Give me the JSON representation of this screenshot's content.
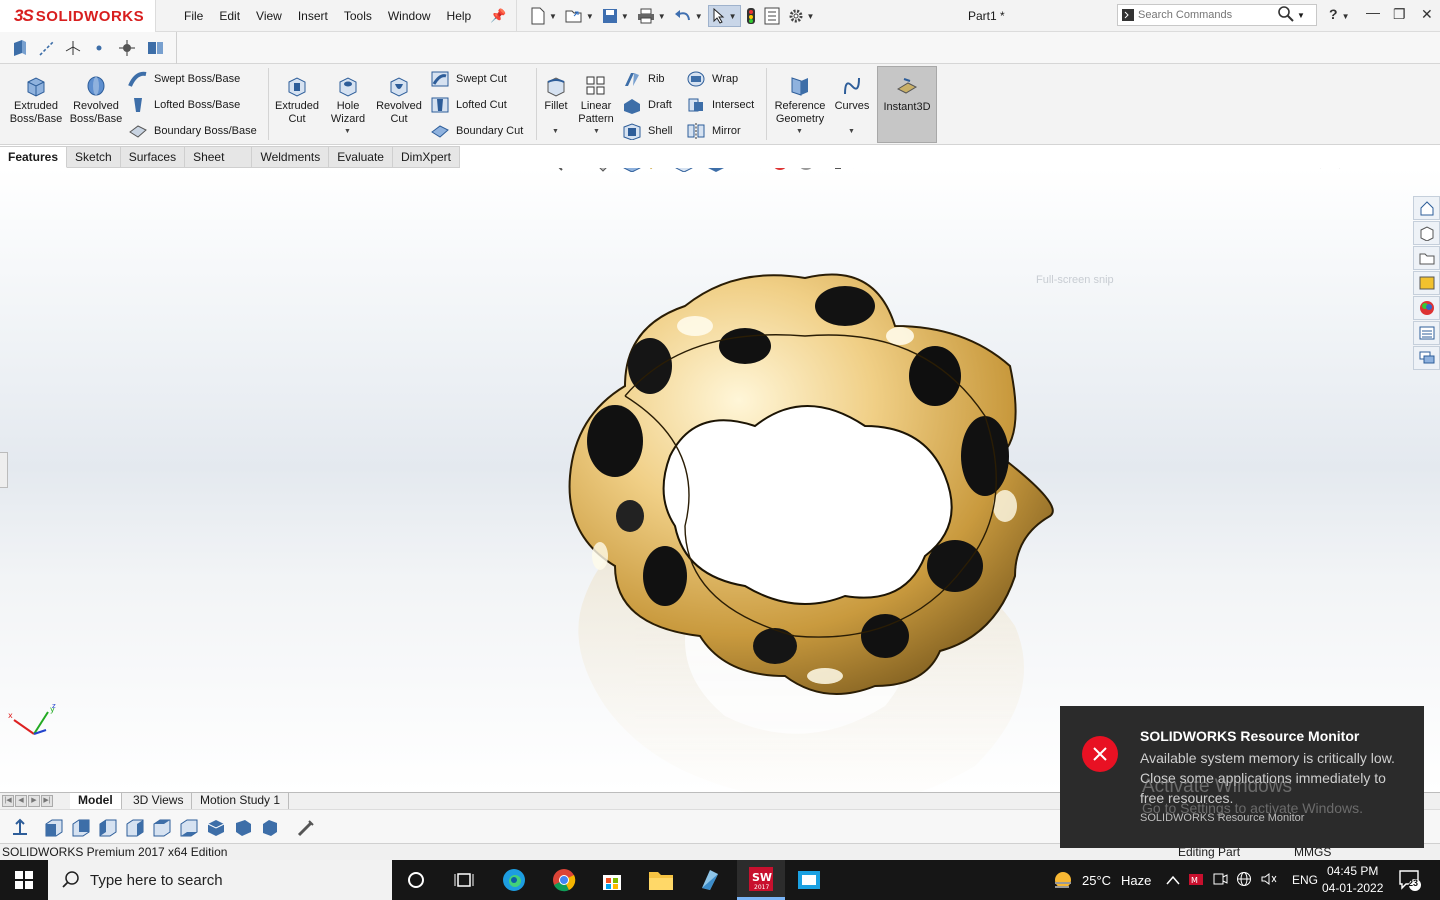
{
  "app": {
    "brand_prefix": "3S",
    "brand_name": "SOLIDWORKS",
    "document_title": "Part1 *"
  },
  "menu": [
    "File",
    "Edit",
    "View",
    "Insert",
    "Tools",
    "Window",
    "Help"
  ],
  "search": {
    "placeholder": "Search Commands"
  },
  "help_label": "?",
  "command_manager": {
    "extruded_boss": "Extruded Boss/Base",
    "revolved_boss": "Revolved Boss/Base",
    "swept_boss": "Swept Boss/Base",
    "lofted_boss": "Lofted Boss/Base",
    "boundary_boss": "Boundary Boss/Base",
    "extruded_cut": "Extruded Cut",
    "hole_wizard": "Hole Wizard",
    "revolved_cut": "Revolved Cut",
    "swept_cut": "Swept Cut",
    "lofted_cut": "Lofted Cut",
    "boundary_cut": "Boundary Cut",
    "fillet": "Fillet",
    "linear_pattern": "Linear Pattern",
    "rib": "Rib",
    "draft": "Draft",
    "shell": "Shell",
    "wrap": "Wrap",
    "intersect": "Intersect",
    "mirror": "Mirror",
    "reference_geometry": "Reference Geometry",
    "curves": "Curves",
    "instant3d": "Instant3D"
  },
  "tabs": [
    "Features",
    "Sketch",
    "Surfaces",
    "Sheet Metal",
    "Weldments",
    "Evaluate",
    "DimXpert"
  ],
  "viewport": {
    "fullscreen_hint": "Full-screen snip"
  },
  "model_tabs": [
    "Model",
    "3D Views",
    "Motion Study 1"
  ],
  "notification": {
    "title": "SOLIDWORKS Resource Monitor",
    "body": "Available system memory is critically low. Close some applications immediately to free resources.",
    "source": "SOLIDWORKS Resource Monitor"
  },
  "watermark": {
    "line1": "Activate Windows",
    "line2": "Go to Settings to activate Windows."
  },
  "status_bar": {
    "edition": "SOLIDWORKS Premium 2017 x64 Edition",
    "mode": "Editing Part",
    "units": "MMGS"
  },
  "taskbar": {
    "search_placeholder": "Type here to search",
    "weather_temp": "25°C",
    "weather_text": "Haze",
    "language": "ENG",
    "time": "04:45 PM",
    "date": "04-01-2022",
    "notification_count": "23"
  },
  "colors": {
    "brand_red": "#d81e1e",
    "error_red": "#e81123",
    "toast_bg": "#2b2b2b",
    "taskbar_bg": "#161616",
    "accent_blue": "#2a6fc9",
    "gold": "#e2b968"
  }
}
